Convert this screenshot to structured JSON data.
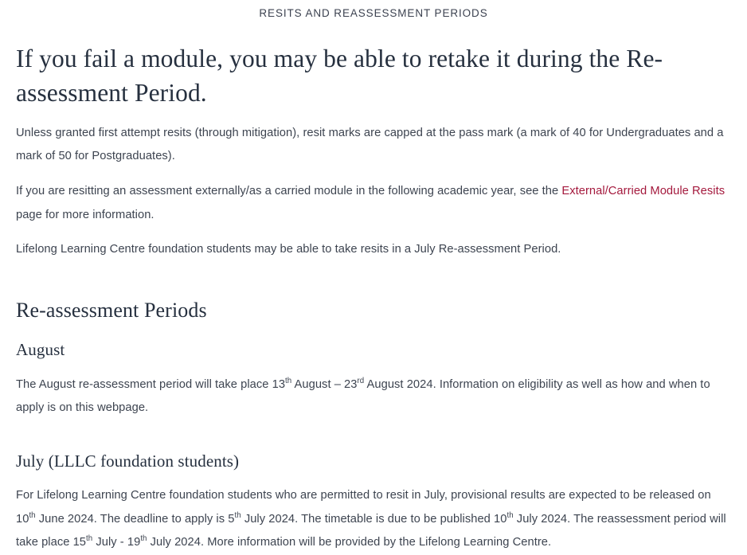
{
  "header": {
    "eyebrow": "RESITS AND REASSESSMENT PERIODS"
  },
  "colors": {
    "link": "#a4193d",
    "heading": "#26303f",
    "body": "#3d4450",
    "background": "#ffffff"
  },
  "main": {
    "lede": "If you fail a module, you may be able to retake it during the Re-assessment Period.",
    "paragraph_capping": "Unless granted first attempt resits (through mitigation), resit marks are capped at the pass mark (a mark of 40 for Undergraduates and a mark of 50 for Postgraduates).",
    "paragraph_external": {
      "before_link": "If you are resitting an assessment externally/as a carried module in the following academic year, see the ",
      "link_text": "External/Carried Module Resits",
      "after_link": " page for more information."
    },
    "paragraph_lllc": "Lifelong Learning Centre foundation students may be able to take resits in a July Re-assessment Period.",
    "section_title": "Re-assessment Periods",
    "august": {
      "heading": "August",
      "text_1": "The August re-assessment period will take place 13",
      "sup_1": "th",
      "text_2": " August – 23",
      "sup_2": "rd",
      "text_3": " August 2024.  Information on eligibility as well as how and when to apply is on this webpage."
    },
    "july": {
      "heading": "July (LLLC foundation students)",
      "text_1": "For Lifelong Learning Centre foundation students who are permitted to resit in July, provisional results are expected to be released on 10",
      "sup_1": "th",
      "text_2": " June 2024.  The deadline to apply is 5",
      "sup_2": "th",
      "text_3": " July 2024.  The timetable is due to be published 10",
      "sup_3": "th",
      "text_4": " July 2024.  The reassessment period will take place 15",
      "sup_4": "th",
      "text_5": " July - 19",
      "sup_5": "th",
      "text_6": " July 2024.  More information will be provided by the Lifelong Learning Centre."
    }
  }
}
